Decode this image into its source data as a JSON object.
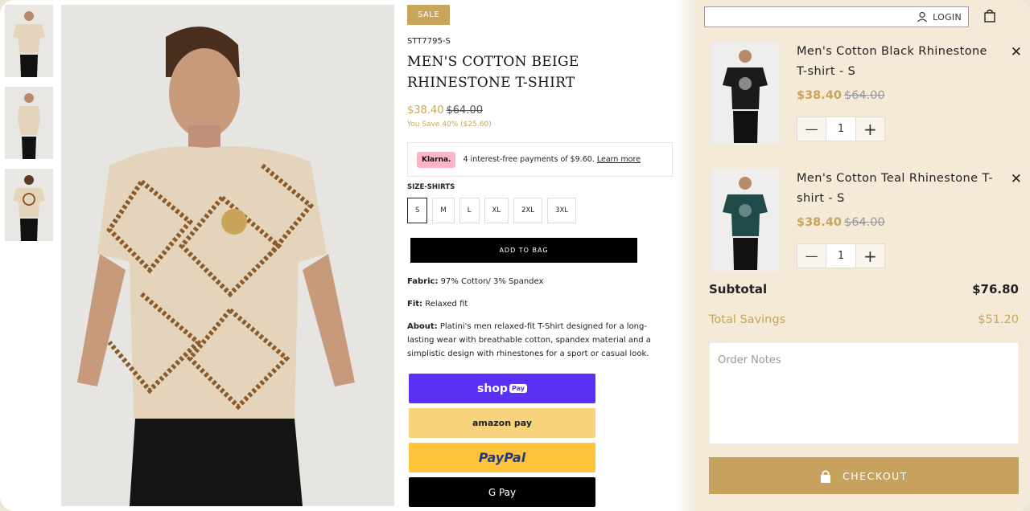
{
  "product": {
    "sale_badge": "SALE",
    "sku": "STT7795-S",
    "title": "MEN'S COTTON BEIGE RHINESTONE T-SHIRT",
    "price": "$38.40",
    "old_price": "$64.00",
    "you_save": "You Save 40% ($25.60)",
    "klarna": {
      "badge": "Klarna.",
      "text": "4 interest-free payments of $9.60.",
      "link": "Learn more"
    },
    "size_label": "SIZE-SHIRTS",
    "sizes": [
      "S",
      "M",
      "L",
      "XL",
      "2XL",
      "3XL"
    ],
    "selected_size": "S",
    "add_to_bag": "ADD TO BAG",
    "fabric_label": "Fabric:",
    "fabric": "97% Cotton/ 3% Spandex",
    "fit_label": "Fit:",
    "fit": "Relaxed fit",
    "about_label": "About:",
    "about": "Platini's men relaxed-fit T-Shirt designed for a long-lasting wear with breathable cotton, spandex material and a simplistic design with rhinestones for a sport or casual look.",
    "pay": {
      "shop": "shop",
      "shop_badge": "Pay",
      "amazon": "amazon pay",
      "paypal_a": "PayPal",
      "gpay": "G Pay"
    }
  },
  "cart": {
    "login": "LOGIN",
    "items": [
      {
        "name": "Men's Cotton Black Rhinestone T-shirt - S",
        "price": "$38.40",
        "old_price": "$64.00",
        "qty": "1",
        "shirt_color": "#1b1b1b"
      },
      {
        "name": "Men's Cotton Teal Rhinestone T-shirt - S",
        "price": "$38.40",
        "old_price": "$64.00",
        "qty": "1",
        "shirt_color": "#1f4c4a"
      }
    ],
    "subtotal_label": "Subtotal",
    "subtotal": "$76.80",
    "savings_label": "Total Savings",
    "savings": "$51.20",
    "notes_placeholder": "Order Notes",
    "checkout": "CHECKOUT"
  },
  "colors": {
    "gold": "#c9a55c",
    "cart_bg": "#f4ead7",
    "shop_purple": "#5a31f4"
  }
}
